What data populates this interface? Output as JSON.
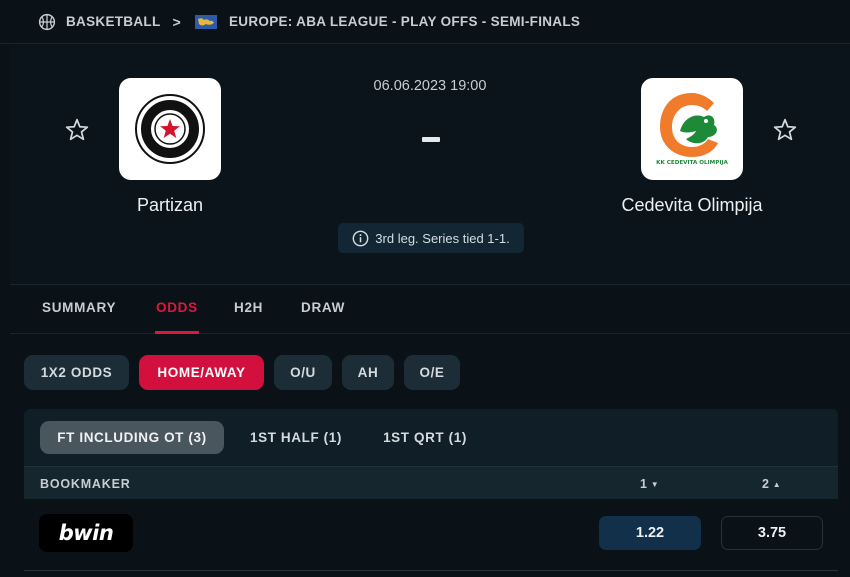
{
  "breadcrumb": {
    "sport": "BASKETBALL",
    "league": "EUROPE: ABA LEAGUE - PLAY OFFS - SEMI-FINALS",
    "separator": ">"
  },
  "match": {
    "datetime": "06.06.2023 19:00",
    "score": "-",
    "info": "3rd leg. Series tied 1-1.",
    "home": {
      "name": "Partizan",
      "logo_text": "PARTIZAN"
    },
    "away": {
      "name": "Cedevita Olimpija",
      "logo_text": "KK CEDEVITA OLIMPIJA"
    }
  },
  "tabs": [
    {
      "label": "SUMMARY",
      "active": false
    },
    {
      "label": "ODDS",
      "active": true
    },
    {
      "label": "H2H",
      "active": false
    },
    {
      "label": "DRAW",
      "active": false
    }
  ],
  "odds_types": [
    {
      "label": "1X2 ODDS",
      "active": false
    },
    {
      "label": "HOME/AWAY",
      "active": true
    },
    {
      "label": "O/U",
      "active": false
    },
    {
      "label": "AH",
      "active": false
    },
    {
      "label": "O/E",
      "active": false
    }
  ],
  "periods": [
    {
      "label": "FT INCLUDING OT (3)",
      "active": true
    },
    {
      "label": "1ST HALF (1)",
      "active": false
    },
    {
      "label": "1ST QRT (1)",
      "active": false
    }
  ],
  "table": {
    "bookmaker_label": "BOOKMAKER",
    "col1": "1",
    "col2": "2",
    "col1_arrow": "▼",
    "col2_arrow": "▲"
  },
  "rows": [
    {
      "bookmaker": "bwin",
      "odd1": "1.22",
      "odd2": "3.75"
    }
  ],
  "colors": {
    "accent": "#e0173c",
    "active_pill": "#d30f3d",
    "background": "#0a1117"
  }
}
